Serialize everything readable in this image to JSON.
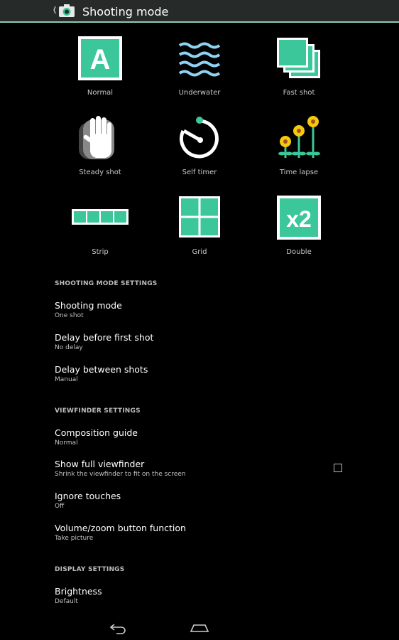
{
  "actionbar": {
    "title": "Shooting mode"
  },
  "modes": [
    {
      "label": "Normal",
      "icon": "letter-a-icon",
      "glyph": "A"
    },
    {
      "label": "Underwater",
      "icon": "waves-icon"
    },
    {
      "label": "Fast shot",
      "icon": "stacked-frames-icon"
    },
    {
      "label": "Steady shot",
      "icon": "hand-icon"
    },
    {
      "label": "Self timer",
      "icon": "timer-icon"
    },
    {
      "label": "Time lapse",
      "icon": "flowers-icon"
    },
    {
      "label": "Strip",
      "icon": "strip-icon"
    },
    {
      "label": "Grid",
      "icon": "grid-icon"
    },
    {
      "label": "Double",
      "icon": "x2-icon",
      "glyph": "x2"
    }
  ],
  "sections": {
    "shooting": "SHOOTING MODE SETTINGS",
    "viewfinder": "VIEWFINDER SETTINGS",
    "display": "DISPLAY SETTINGS"
  },
  "prefs": {
    "shooting_mode": {
      "title": "Shooting mode",
      "summary": "One shot"
    },
    "delay_first": {
      "title": "Delay before first shot",
      "summary": "No delay"
    },
    "delay_between": {
      "title": "Delay between shots",
      "summary": "Manual"
    },
    "composition": {
      "title": "Composition guide",
      "summary": "Normal"
    },
    "full_viewfinder": {
      "title": "Show full viewfinder",
      "summary": "Shrink the viewfinder to fit on the screen",
      "checked": false
    },
    "ignore_touches": {
      "title": "Ignore touches",
      "summary": "Off"
    },
    "volume_zoom": {
      "title": "Volume/zoom button function",
      "summary": "Take picture"
    },
    "brightness": {
      "title": "Brightness",
      "summary": "Default"
    }
  },
  "colors": {
    "accent": "#3cc79a",
    "actionbar": "#262b29",
    "divider": "#8ccab1",
    "water": "#8fd3f4",
    "flower": "#f6c90e"
  },
  "navbar": {
    "back": "back-icon",
    "home": "home-icon"
  }
}
